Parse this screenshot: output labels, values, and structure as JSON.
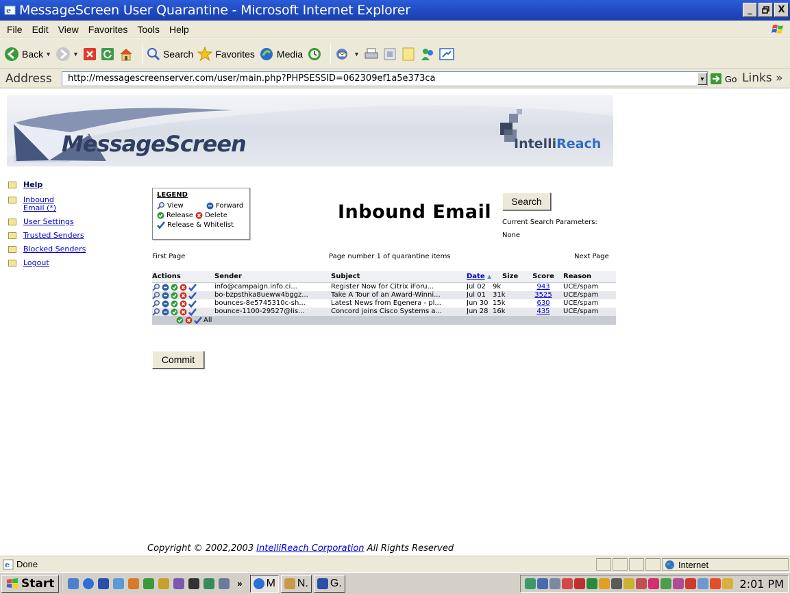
{
  "window": {
    "title": "MessageScreen User Quarantine - Microsoft Internet Explorer",
    "minimize": "_",
    "maximize": "×",
    "close": "X"
  },
  "menu": [
    "File",
    "Edit",
    "View",
    "Favorites",
    "Tools",
    "Help"
  ],
  "toolbar": {
    "back": "Back",
    "search": "Search",
    "favorites": "Favorites",
    "media": "Media"
  },
  "address": {
    "label": "Address",
    "url": "http://messagescreenserver.com/user/main.php?PHPSESSID=062309ef1a5e373ca",
    "go": "Go",
    "links": "Links »"
  },
  "banner": {
    "product": "MessageScreen",
    "company_a": "Intelli",
    "company_b": "Reach"
  },
  "nav": [
    {
      "label": "Help"
    },
    {
      "label": "Inbound Email (*)"
    },
    {
      "label": "User Settings"
    },
    {
      "label": "Trusted Senders"
    },
    {
      "label": "Blocked Senders"
    },
    {
      "label": "Logout"
    }
  ],
  "legend": {
    "title": "LEGEND",
    "view": "View",
    "forward": "Forward",
    "release": "Release",
    "delete": "Delete",
    "release_whitelist": "Release & Whitelist"
  },
  "page": {
    "heading": "Inbound Email",
    "search_button": "Search",
    "search_params_label": "Current Search Parameters:",
    "search_params_value": "None",
    "first_page": "First Page",
    "page_info": "Page number 1 of quarantine items",
    "next_page": "Next Page",
    "commit": "Commit"
  },
  "table": {
    "headers": {
      "actions": "Actions",
      "sender": "Sender",
      "subject": "Subject",
      "date": "Date",
      "size": "Size",
      "score": "Score",
      "reason": "Reason"
    },
    "rows": [
      {
        "sender": "info@campaign.info.ci...",
        "subject": "Register Now for Citrix iForu...",
        "date": "Jul 02",
        "size": "9k",
        "score": "943",
        "reason": "UCE/spam"
      },
      {
        "sender": "bo-bzpsthka8ueww4bggz...",
        "subject": "Take A Tour of an Award-Winni...",
        "date": "Jul 01",
        "size": "31k",
        "score": "3525",
        "reason": "UCE/spam"
      },
      {
        "sender": "bounces-8e5745310c-sh...",
        "subject": "Latest News from Egenera - pl...",
        "date": "Jun 30",
        "size": "15k",
        "score": "630",
        "reason": "UCE/spam"
      },
      {
        "sender": "bounce-1100-29527@lis...",
        "subject": "Concord joins Cisco Systems a...",
        "date": "Jun 28",
        "size": "16k",
        "score": "435",
        "reason": "UCE/spam"
      }
    ],
    "all_label": "All"
  },
  "footer": {
    "prefix": "Copyright © 2002,2003 ",
    "company_link": "IntelliReach Corporation",
    "suffix": " All Rights Reserved"
  },
  "status": {
    "text": "Done",
    "zone": "Internet"
  },
  "taskbar": {
    "start": "Start",
    "chevron": "»",
    "tasks": [
      "M",
      "N.",
      "G."
    ],
    "clock": "2:01 PM"
  },
  "colors": {
    "titlebar": "#2a5dd8",
    "link": "#0000cc",
    "view_icon": "#5a6e9a",
    "forward_icon": "#2f5fa8",
    "release_icon": "#2f9a3a",
    "delete_icon": "#d03020",
    "whitelist_icon": "#3a5ab0"
  }
}
